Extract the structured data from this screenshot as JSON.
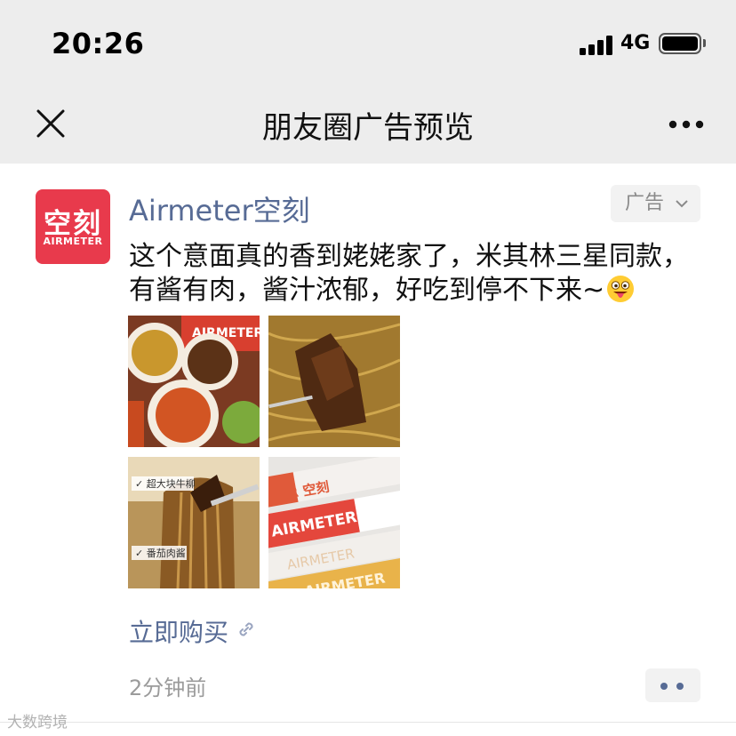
{
  "status_bar": {
    "time": "20:26",
    "network": "4G",
    "battery_level": 1.0
  },
  "header": {
    "title": "朋友圈广告预览",
    "close_icon": "close-icon",
    "more_icon": "more-dots-icon"
  },
  "ad": {
    "avatar": {
      "logo_text": "空刻",
      "logo_subtext": "AIRMETER",
      "color": "#e83a4c"
    },
    "brand_name": "Airmeter空刻",
    "tag_label": "广告",
    "text_line1": "这个意面真的香到姥姥家了，米其林三星同款，",
    "text_line2": "有酱有肉，酱汁浓郁，好吃到停不下来~",
    "emoji": "tongue-out-emoji",
    "images": [
      {
        "icon": "pasta-plates-photo"
      },
      {
        "icon": "beef-pasta-photo"
      },
      {
        "icon": "pasta-fork-photo",
        "labels": [
          "超大块牛柳",
          "番茄肉酱"
        ]
      },
      {
        "icon": "product-boxes-photo",
        "box_text": "AIRMETER",
        "box_cn": "空刻"
      }
    ],
    "cta_label": "立即购买",
    "timestamp": "2分钟前"
  },
  "watermark": "大数跨境",
  "colors": {
    "header_bg": "#ededed",
    "link_blue": "#576b95",
    "brand_red": "#e83a4c",
    "muted_gray": "#9b9b9b"
  }
}
